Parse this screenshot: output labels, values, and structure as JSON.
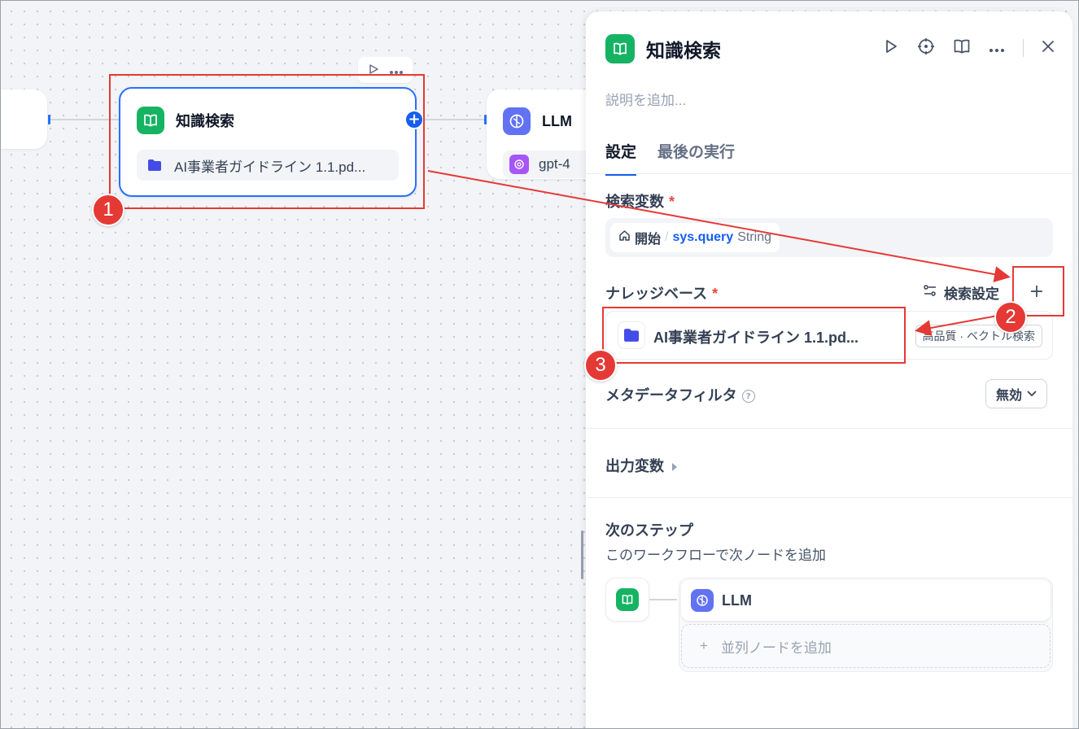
{
  "canvas": {
    "knowledge_node": {
      "title": "知識検索",
      "kb_item": "AI事業者ガイドライン 1.1.pd...",
      "icon": "book-icon"
    },
    "llm_node": {
      "title": "LLM",
      "model": "gpt-4",
      "icon": "brain-icon",
      "model_icon": "openai-icon"
    },
    "toolbar_icons": [
      "play-icon",
      "more-icon"
    ]
  },
  "panel": {
    "title": "知識検索",
    "description_placeholder": "説明を追加...",
    "actions": [
      "play-icon",
      "crosshair-icon",
      "book-open-icon",
      "more-icon",
      "close-icon"
    ],
    "tabs": [
      {
        "label": "設定",
        "active": true
      },
      {
        "label": "最後の実行",
        "active": false
      }
    ],
    "query_variable": {
      "label": "検索変数",
      "required_mark": "*",
      "source": "開始",
      "separator": "/",
      "name": "sys.query",
      "type": "String"
    },
    "knowledge_base": {
      "label": "ナレッジベース",
      "required_mark": "*",
      "settings_label": "検索設定",
      "add_label": "+",
      "item_name": "AI事業者ガイドライン 1.1.pd...",
      "item_badge": "高品質 · ベクトル検索"
    },
    "metadata_filter": {
      "label": "メタデータフィルタ",
      "help": "?",
      "value": "無効"
    },
    "output_vars": {
      "label": "出力変数"
    },
    "next_step": {
      "label": "次のステップ",
      "description": "このワークフローで次ノードを追加",
      "next_node": "LLM",
      "add_parallel_plus": "+",
      "add_parallel": "並列ノードを追加"
    }
  },
  "annotations": {
    "markers": [
      "1",
      "2",
      "3"
    ],
    "color": "#e53935"
  },
  "colors": {
    "accent": "#155eef",
    "knowledge_green": "#16b364",
    "llm_indigo": "#6172f3",
    "required_red": "#f04438"
  }
}
